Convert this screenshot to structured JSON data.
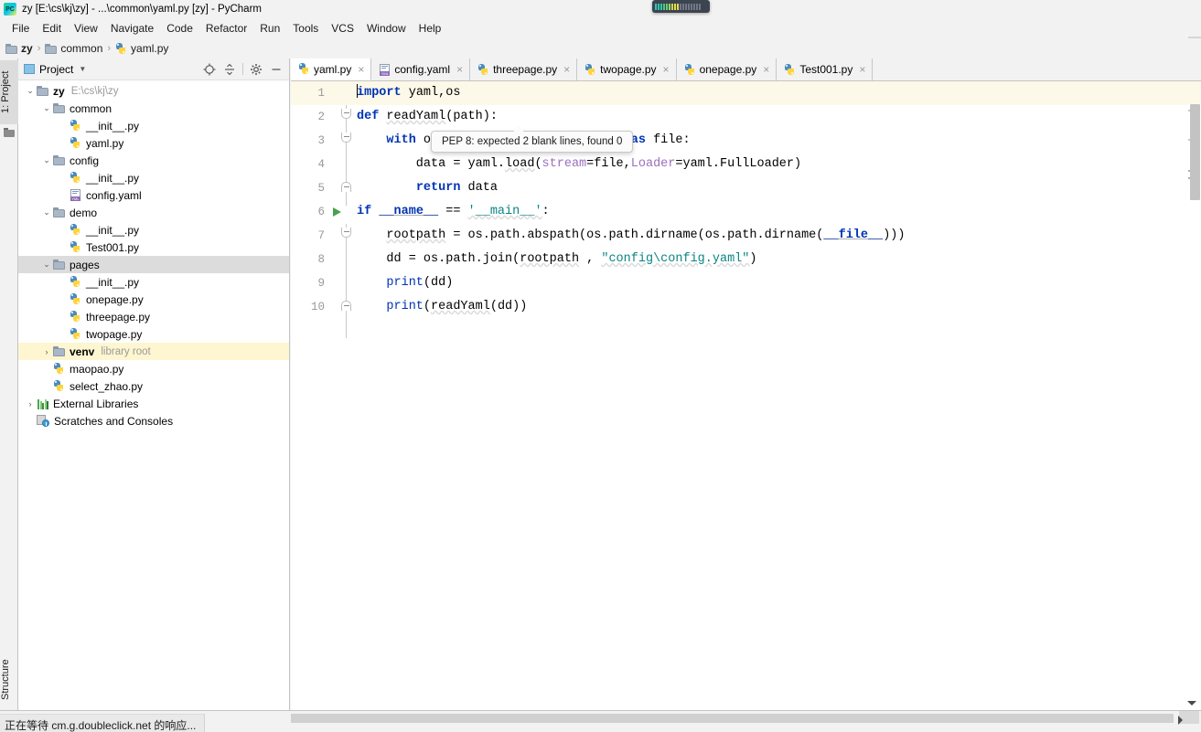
{
  "window": {
    "title": "zy [E:\\cs\\kj\\zy] - ...\\common\\yaml.py [zy] - PyCharm",
    "app_icon": "pycharm-logo-icon"
  },
  "menubar": {
    "items": [
      {
        "label": "File"
      },
      {
        "label": "Edit"
      },
      {
        "label": "View"
      },
      {
        "label": "Navigate"
      },
      {
        "label": "Code"
      },
      {
        "label": "Refactor"
      },
      {
        "label": "Run"
      },
      {
        "label": "Tools"
      },
      {
        "label": "VCS"
      },
      {
        "label": "Window"
      },
      {
        "label": "Help"
      }
    ]
  },
  "breadcrumb": {
    "items": [
      {
        "label": "zy",
        "icon": "folder-icon",
        "bold": true
      },
      {
        "label": "common",
        "icon": "folder-icon",
        "bold": false
      },
      {
        "label": "yaml.py",
        "icon": "python-file-icon",
        "bold": false
      }
    ],
    "separator": "›"
  },
  "left_strip": {
    "project_label": "1: Project",
    "structure_label": "Structure"
  },
  "project_panel": {
    "title": "Project",
    "caret": "▼",
    "tools": [
      {
        "name": "locate-target-icon",
        "glyph": "⊕"
      },
      {
        "name": "collapse-all-icon",
        "glyph": "⩽"
      },
      {
        "name": "settings-gear-icon",
        "glyph": "⚙"
      },
      {
        "name": "hide-panel-icon",
        "glyph": "—"
      }
    ],
    "tree": [
      {
        "label": "zy",
        "sub": "E:\\cs\\kj\\zy",
        "icon": "folder-icon",
        "indent": 0,
        "arrow": "⌄",
        "bold": true,
        "state": ""
      },
      {
        "label": "common",
        "sub": "",
        "icon": "folder-icon",
        "indent": 1,
        "arrow": "⌄",
        "bold": false,
        "state": ""
      },
      {
        "label": "__init__.py",
        "sub": "",
        "icon": "python-file-icon",
        "indent": 2,
        "arrow": "",
        "bold": false,
        "state": ""
      },
      {
        "label": "yaml.py",
        "sub": "",
        "icon": "python-file-icon",
        "indent": 2,
        "arrow": "",
        "bold": false,
        "state": ""
      },
      {
        "label": "config",
        "sub": "",
        "icon": "folder-icon",
        "indent": 1,
        "arrow": "⌄",
        "bold": false,
        "state": ""
      },
      {
        "label": "__init__.py",
        "sub": "",
        "icon": "python-file-icon",
        "indent": 2,
        "arrow": "",
        "bold": false,
        "state": ""
      },
      {
        "label": "config.yaml",
        "sub": "",
        "icon": "yaml-file-icon",
        "indent": 2,
        "arrow": "",
        "bold": false,
        "state": ""
      },
      {
        "label": "demo",
        "sub": "",
        "icon": "folder-icon",
        "indent": 1,
        "arrow": "⌄",
        "bold": false,
        "state": ""
      },
      {
        "label": "__init__.py",
        "sub": "",
        "icon": "python-file-icon",
        "indent": 2,
        "arrow": "",
        "bold": false,
        "state": ""
      },
      {
        "label": "Test001.py",
        "sub": "",
        "icon": "python-file-icon",
        "indent": 2,
        "arrow": "",
        "bold": false,
        "state": ""
      },
      {
        "label": "pages",
        "sub": "",
        "icon": "folder-icon",
        "indent": 1,
        "arrow": "⌄",
        "bold": false,
        "state": "selected"
      },
      {
        "label": "__init__.py",
        "sub": "",
        "icon": "python-file-icon",
        "indent": 2,
        "arrow": "",
        "bold": false,
        "state": ""
      },
      {
        "label": "onepage.py",
        "sub": "",
        "icon": "python-file-icon",
        "indent": 2,
        "arrow": "",
        "bold": false,
        "state": ""
      },
      {
        "label": "threepage.py",
        "sub": "",
        "icon": "python-file-icon",
        "indent": 2,
        "arrow": "",
        "bold": false,
        "state": ""
      },
      {
        "label": "twopage.py",
        "sub": "",
        "icon": "python-file-icon",
        "indent": 2,
        "arrow": "",
        "bold": false,
        "state": ""
      },
      {
        "label": "venv",
        "sub": "library root",
        "icon": "folder-icon",
        "indent": 1,
        "arrow": "›",
        "bold": true,
        "state": "highlighted"
      },
      {
        "label": "maopao.py",
        "sub": "",
        "icon": "python-file-icon",
        "indent": 1,
        "arrow": "",
        "bold": false,
        "state": ""
      },
      {
        "label": "select_zhao.py",
        "sub": "",
        "icon": "python-file-icon",
        "indent": 1,
        "arrow": "",
        "bold": false,
        "state": ""
      },
      {
        "label": "External Libraries",
        "sub": "",
        "icon": "library-bars-icon",
        "indent": 0,
        "arrow": "›",
        "bold": false,
        "state": ""
      },
      {
        "label": "Scratches and Consoles",
        "sub": "",
        "icon": "scratches-icon",
        "indent": 0,
        "arrow": "",
        "bold": false,
        "state": ""
      }
    ]
  },
  "editor": {
    "tabs": [
      {
        "label": "yaml.py",
        "icon": "python-file-icon",
        "active": true,
        "close": "×"
      },
      {
        "label": "config.yaml",
        "icon": "yaml-file-icon",
        "active": false,
        "close": "×"
      },
      {
        "label": "threepage.py",
        "icon": "python-file-icon",
        "active": false,
        "close": "×"
      },
      {
        "label": "twopage.py",
        "icon": "python-file-icon",
        "active": false,
        "close": "×"
      },
      {
        "label": "onepage.py",
        "icon": "python-file-icon",
        "active": false,
        "close": "×"
      },
      {
        "label": "Test001.py",
        "icon": "python-file-icon",
        "active": false,
        "close": "×"
      }
    ],
    "line_numbers": [
      "1",
      "2",
      "3",
      "4",
      "5",
      "6",
      "7",
      "8",
      "9",
      "10"
    ],
    "code_lines": [
      {
        "n": 1,
        "text": "import yaml,os"
      },
      {
        "n": 2,
        "text": "def readYaml(path):"
      },
      {
        "n": 3,
        "text": "    with open(path,encoding=\"utf-8\") as file:"
      },
      {
        "n": 4,
        "text": "        data = yaml.load(stream=file,Loader=yaml.FullLoader)"
      },
      {
        "n": 5,
        "text": "        return data"
      },
      {
        "n": 6,
        "text": "if __name__ == '__main__':"
      },
      {
        "n": 7,
        "text": "    rootpath = os.path.abspath(os.path.dirname(os.path.dirname(__file__)))"
      },
      {
        "n": 8,
        "text": "    dd = os.path.join(rootpath , \"config\\config.yaml\")"
      },
      {
        "n": 9,
        "text": "    print(dd)"
      },
      {
        "n": 10,
        "text": "    print(readYaml(dd))"
      }
    ],
    "run_marker_line": 6,
    "tooltip": {
      "text": "PEP 8: expected 2 blank lines, found 0"
    }
  },
  "status": {
    "toast": "正在等待 cm.g.doubleclick.net 的响应..."
  },
  "colors": {
    "keyword": "#0033b3",
    "string_green": "#067d17",
    "string_teal": "#0b8484",
    "named_arg": "#9a6ec0",
    "run_green": "#48a14d",
    "selection_gray": "#dcdcdc",
    "highlight_yellow": "#fdf6d0",
    "caret_line": "#fdf9e8"
  }
}
